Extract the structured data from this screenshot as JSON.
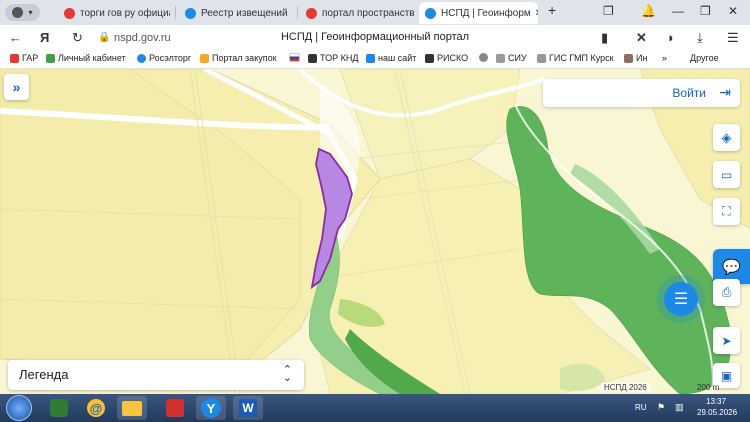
{
  "browser": {
    "tabs": [
      {
        "label": "торги гов ру официал",
        "color": "#e53935"
      },
      {
        "label": "Реестр извещений",
        "color": "#1e88e5"
      },
      {
        "label": "портал пространств",
        "color": "#e53935"
      },
      {
        "label": "НСПД | Геоинформ",
        "color": "#1e88e5",
        "active": true
      }
    ],
    "new_tab": "+",
    "url": "nspd.gov.ru",
    "page_title": "НСПД | Геоинформационный портал"
  },
  "bookmarks": {
    "items": [
      {
        "label": "ГАР",
        "color": "#e53935"
      },
      {
        "label": "Личный кабинет",
        "color": "#43a047"
      },
      {
        "label": "Росэлторг",
        "color": "#1e88e5"
      },
      {
        "label": "Портал закупок",
        "color": "#f9a825"
      },
      {
        "label": "",
        "color": "#d32f2f"
      },
      {
        "label": "ТОР КНД",
        "color": "#333333"
      },
      {
        "label": "наш сайт",
        "color": "#1e88e5"
      },
      {
        "label": "РИСКО",
        "color": "#333333"
      },
      {
        "label": "",
        "color": "#666666"
      },
      {
        "label": "СИУ",
        "color": "#555555"
      },
      {
        "label": "ГИС ГМП Курск",
        "color": "#555555"
      },
      {
        "label": "Ин",
        "color": "#8d6e63"
      }
    ],
    "more_label": "Другое"
  },
  "map": {
    "login_label": "Войти",
    "legend_label": "Легенда",
    "attribution": "НСПД 2026",
    "scale_label": "200 m"
  },
  "taskbar": {
    "lang": "RU",
    "time": "13:37",
    "date": "29.05.2026"
  },
  "colors": {
    "map_bg": "#f8f5cf",
    "field": "#f5eeaf",
    "forest": "#5fb35a",
    "parcel": "#b887e3",
    "accent": "#1565c0"
  }
}
